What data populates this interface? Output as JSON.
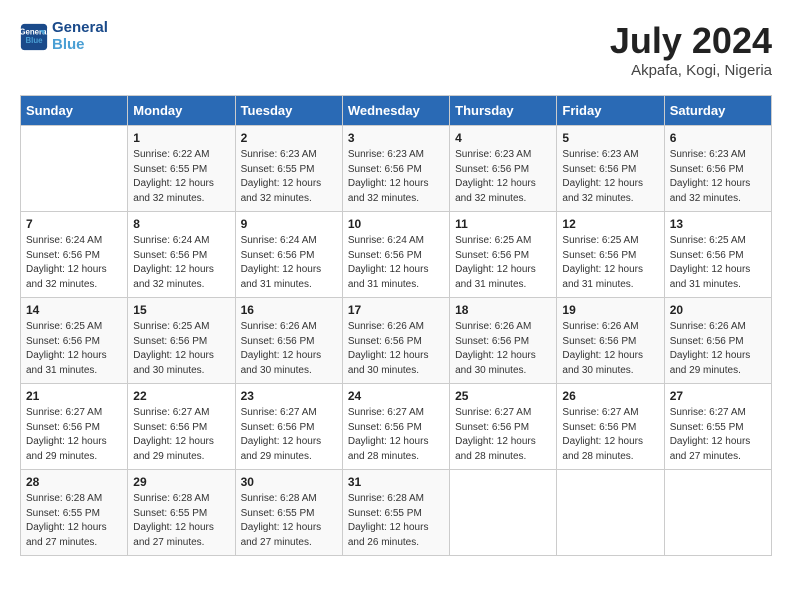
{
  "header": {
    "logo_line1": "General",
    "logo_line2": "Blue",
    "month_title": "July 2024",
    "location": "Akpafa, Kogi, Nigeria"
  },
  "days_of_week": [
    "Sunday",
    "Monday",
    "Tuesday",
    "Wednesday",
    "Thursday",
    "Friday",
    "Saturday"
  ],
  "weeks": [
    [
      {
        "num": "",
        "info": ""
      },
      {
        "num": "1",
        "info": "Sunrise: 6:22 AM\nSunset: 6:55 PM\nDaylight: 12 hours\nand 32 minutes."
      },
      {
        "num": "2",
        "info": "Sunrise: 6:23 AM\nSunset: 6:55 PM\nDaylight: 12 hours\nand 32 minutes."
      },
      {
        "num": "3",
        "info": "Sunrise: 6:23 AM\nSunset: 6:56 PM\nDaylight: 12 hours\nand 32 minutes."
      },
      {
        "num": "4",
        "info": "Sunrise: 6:23 AM\nSunset: 6:56 PM\nDaylight: 12 hours\nand 32 minutes."
      },
      {
        "num": "5",
        "info": "Sunrise: 6:23 AM\nSunset: 6:56 PM\nDaylight: 12 hours\nand 32 minutes."
      },
      {
        "num": "6",
        "info": "Sunrise: 6:23 AM\nSunset: 6:56 PM\nDaylight: 12 hours\nand 32 minutes."
      }
    ],
    [
      {
        "num": "7",
        "info": "Sunrise: 6:24 AM\nSunset: 6:56 PM\nDaylight: 12 hours\nand 32 minutes."
      },
      {
        "num": "8",
        "info": "Sunrise: 6:24 AM\nSunset: 6:56 PM\nDaylight: 12 hours\nand 32 minutes."
      },
      {
        "num": "9",
        "info": "Sunrise: 6:24 AM\nSunset: 6:56 PM\nDaylight: 12 hours\nand 31 minutes."
      },
      {
        "num": "10",
        "info": "Sunrise: 6:24 AM\nSunset: 6:56 PM\nDaylight: 12 hours\nand 31 minutes."
      },
      {
        "num": "11",
        "info": "Sunrise: 6:25 AM\nSunset: 6:56 PM\nDaylight: 12 hours\nand 31 minutes."
      },
      {
        "num": "12",
        "info": "Sunrise: 6:25 AM\nSunset: 6:56 PM\nDaylight: 12 hours\nand 31 minutes."
      },
      {
        "num": "13",
        "info": "Sunrise: 6:25 AM\nSunset: 6:56 PM\nDaylight: 12 hours\nand 31 minutes."
      }
    ],
    [
      {
        "num": "14",
        "info": "Sunrise: 6:25 AM\nSunset: 6:56 PM\nDaylight: 12 hours\nand 31 minutes."
      },
      {
        "num": "15",
        "info": "Sunrise: 6:25 AM\nSunset: 6:56 PM\nDaylight: 12 hours\nand 30 minutes."
      },
      {
        "num": "16",
        "info": "Sunrise: 6:26 AM\nSunset: 6:56 PM\nDaylight: 12 hours\nand 30 minutes."
      },
      {
        "num": "17",
        "info": "Sunrise: 6:26 AM\nSunset: 6:56 PM\nDaylight: 12 hours\nand 30 minutes."
      },
      {
        "num": "18",
        "info": "Sunrise: 6:26 AM\nSunset: 6:56 PM\nDaylight: 12 hours\nand 30 minutes."
      },
      {
        "num": "19",
        "info": "Sunrise: 6:26 AM\nSunset: 6:56 PM\nDaylight: 12 hours\nand 30 minutes."
      },
      {
        "num": "20",
        "info": "Sunrise: 6:26 AM\nSunset: 6:56 PM\nDaylight: 12 hours\nand 29 minutes."
      }
    ],
    [
      {
        "num": "21",
        "info": "Sunrise: 6:27 AM\nSunset: 6:56 PM\nDaylight: 12 hours\nand 29 minutes."
      },
      {
        "num": "22",
        "info": "Sunrise: 6:27 AM\nSunset: 6:56 PM\nDaylight: 12 hours\nand 29 minutes."
      },
      {
        "num": "23",
        "info": "Sunrise: 6:27 AM\nSunset: 6:56 PM\nDaylight: 12 hours\nand 29 minutes."
      },
      {
        "num": "24",
        "info": "Sunrise: 6:27 AM\nSunset: 6:56 PM\nDaylight: 12 hours\nand 28 minutes."
      },
      {
        "num": "25",
        "info": "Sunrise: 6:27 AM\nSunset: 6:56 PM\nDaylight: 12 hours\nand 28 minutes."
      },
      {
        "num": "26",
        "info": "Sunrise: 6:27 AM\nSunset: 6:56 PM\nDaylight: 12 hours\nand 28 minutes."
      },
      {
        "num": "27",
        "info": "Sunrise: 6:27 AM\nSunset: 6:55 PM\nDaylight: 12 hours\nand 27 minutes."
      }
    ],
    [
      {
        "num": "28",
        "info": "Sunrise: 6:28 AM\nSunset: 6:55 PM\nDaylight: 12 hours\nand 27 minutes."
      },
      {
        "num": "29",
        "info": "Sunrise: 6:28 AM\nSunset: 6:55 PM\nDaylight: 12 hours\nand 27 minutes."
      },
      {
        "num": "30",
        "info": "Sunrise: 6:28 AM\nSunset: 6:55 PM\nDaylight: 12 hours\nand 27 minutes."
      },
      {
        "num": "31",
        "info": "Sunrise: 6:28 AM\nSunset: 6:55 PM\nDaylight: 12 hours\nand 26 minutes."
      },
      {
        "num": "",
        "info": ""
      },
      {
        "num": "",
        "info": ""
      },
      {
        "num": "",
        "info": ""
      }
    ]
  ]
}
